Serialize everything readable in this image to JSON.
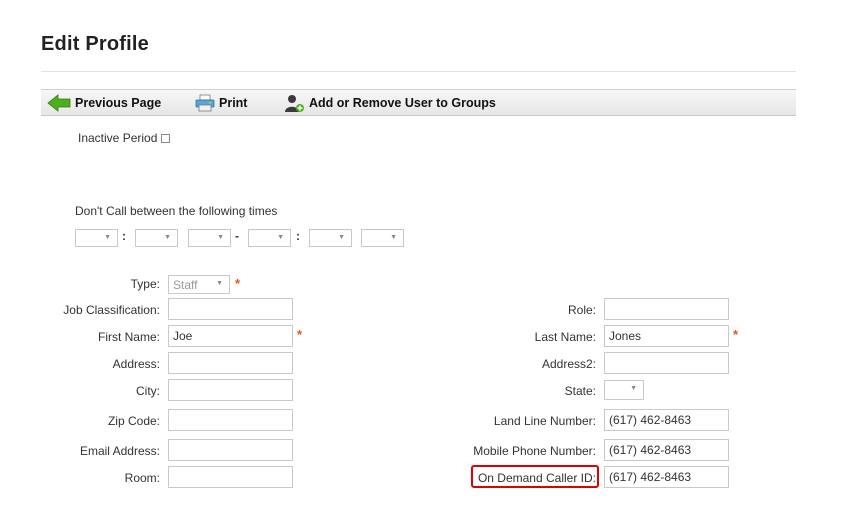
{
  "page": {
    "title": "Edit Profile"
  },
  "toolbar": {
    "previous_label": "Previous Page",
    "print_label": "Print",
    "groups_label": "Add or Remove User to Groups"
  },
  "inactive_period": {
    "label": "Inactive Period",
    "checked": false
  },
  "dont_call": {
    "label": "Don't Call between the following times",
    "colon": ":",
    "dash": "-"
  },
  "form": {
    "type": {
      "label": "Type:",
      "value": "Staff"
    },
    "job_classification": {
      "label": "Job Classification:",
      "value": ""
    },
    "role": {
      "label": "Role:",
      "value": ""
    },
    "first_name": {
      "label": "First Name:",
      "value": "Joe"
    },
    "last_name": {
      "label": "Last Name:",
      "value": "Jones"
    },
    "address": {
      "label": "Address:",
      "value": ""
    },
    "address2": {
      "label": "Address2:",
      "value": ""
    },
    "city": {
      "label": "City:",
      "value": ""
    },
    "state": {
      "label": "State:",
      "value": ""
    },
    "zip": {
      "label": "Zip Code:",
      "value": ""
    },
    "land_line": {
      "label": "Land Line Number:",
      "value": "(617) 462-8463"
    },
    "email": {
      "label": "Email Address:",
      "value": ""
    },
    "mobile": {
      "label": "Mobile Phone Number:",
      "value": "(617) 462-8463"
    },
    "room": {
      "label": "Room:",
      "value": ""
    },
    "on_demand_caller_id": {
      "label": "On Demand Caller ID:",
      "value": "(617) 462-8463"
    },
    "required_marker": "*"
  },
  "colors": {
    "required": "#e8541c",
    "highlight": "#e00000",
    "back_arrow": "#4caf1d"
  }
}
